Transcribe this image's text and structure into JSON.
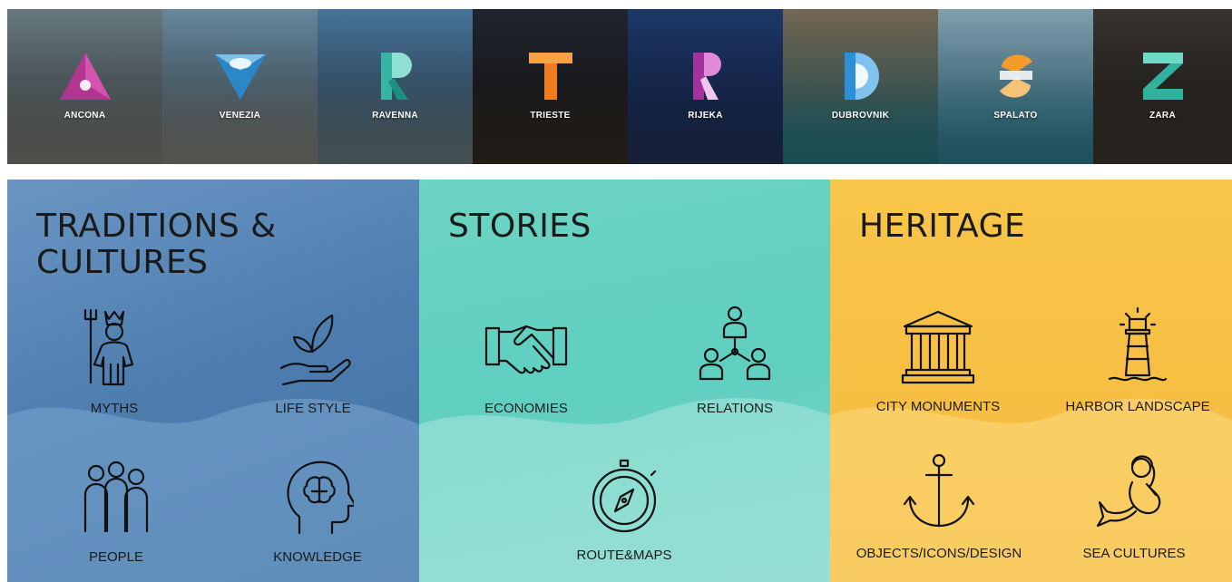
{
  "cities": [
    {
      "name": "ANCONA",
      "logo": "triangle-icon",
      "color": "#b0368f",
      "bg1": "#6d7f86",
      "bg2": "#3b4145",
      "land": "#8f8b7a"
    },
    {
      "name": "VENEZIA",
      "logo": "inverted-triangle-icon",
      "color": "#2c87c8",
      "bg1": "#6b8fa6",
      "bg2": "#3e4a4e",
      "land": "#9a8c78"
    },
    {
      "name": "RAVENNA",
      "logo": "letter-r-icon",
      "color": "#37b5a4",
      "bg1": "#4a7aa3",
      "bg2": "#2d3e47",
      "land": "#7f8c8a"
    },
    {
      "name": "TRIESTE",
      "logo": "letter-t-icon",
      "color": "#f07c22",
      "bg1": "#202733",
      "bg2": "#1a1410",
      "land": "#3e3426"
    },
    {
      "name": "RIJEKA",
      "logo": "letter-r-icon",
      "color": "#a3329c",
      "bg1": "#1f3b6e",
      "bg2": "#0f1c3d",
      "land": "#2a3558"
    },
    {
      "name": "DUBROVNIK",
      "logo": "letter-d-icon",
      "color": "#2e8fd6",
      "bg1": "#7a6c57",
      "bg2": "#1e5963",
      "land": "#1f6f78"
    },
    {
      "name": "SPALATO",
      "logo": "letter-s-icon",
      "color": "#f39b2b",
      "bg1": "#8aa7b7",
      "bg2": "#1f6274",
      "land": "#2f6f80"
    },
    {
      "name": "ZARA",
      "logo": "letter-z-icon",
      "color": "#2fb39e",
      "bg1": "#3b3632",
      "bg2": "#1d1a18",
      "land": "#4a3f38"
    }
  ],
  "panels": [
    {
      "title_line1": "TRADITIONS &",
      "title_line2": "CULTURES",
      "color": "#4f7fb0",
      "items": [
        "MYTHS",
        "LIFE STYLE",
        "PEOPLE",
        "KNOWLEDGE"
      ]
    },
    {
      "title_line1": "STORIES",
      "color": "#5fcfbf",
      "items": [
        "ECONOMIES",
        "RELATIONS",
        "ROUTE&MAPS"
      ]
    },
    {
      "title_line1": "HERITAGE",
      "color": "#f7c044",
      "items": [
        "CITY MONUMENTS",
        "HARBOR LANDSCAPE",
        "OBJECTS/ICONS/DESIGN",
        "SEA CULTURES"
      ]
    }
  ]
}
